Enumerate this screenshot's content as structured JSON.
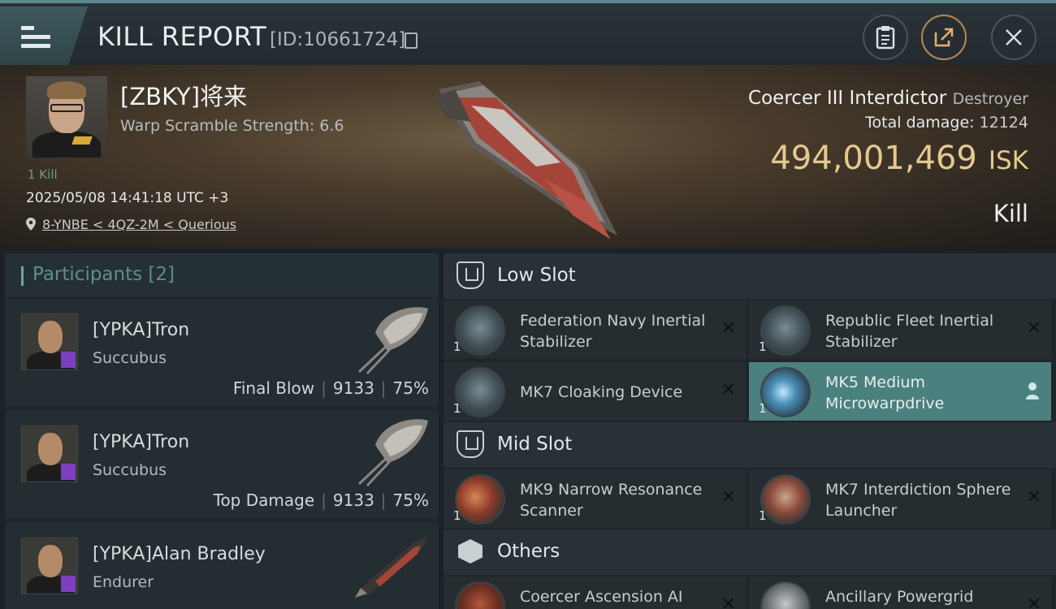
{
  "header": {
    "title": "KILL REPORT",
    "report_id": "[ID:10661724]"
  },
  "victim": {
    "name": "[ZBKY]将来",
    "warp_scramble": "Warp Scramble Strength: 6.6",
    "kills": "1 Kill",
    "timestamp": "2025/05/08 14:41:18 UTC +3",
    "location": "8-YNBE < 4QZ-2M < Querious"
  },
  "ship": {
    "name": "Coercer III Interdictor",
    "class": "Destroyer",
    "total_damage_label": "Total damage:",
    "total_damage": "12124",
    "isk_value": "494,001,469",
    "isk_unit": "ISK",
    "result": "Kill"
  },
  "participants": {
    "header": "Participants [2]",
    "list": [
      {
        "name": "[YPKA]Tron",
        "ship": "Succubus",
        "role": "Final Blow",
        "damage": "9133",
        "percent": "75%"
      },
      {
        "name": "[YPKA]Tron",
        "ship": "Succubus",
        "role": "Top Damage",
        "damage": "9133",
        "percent": "75%"
      },
      {
        "name": "[YPKA]Alan Bradley",
        "ship": "Endurer"
      }
    ]
  },
  "fitting": {
    "low_slot": {
      "label": "Low Slot",
      "modules": [
        {
          "name": "Federation Navy Inertial Stabilizer",
          "qty": "1"
        },
        {
          "name": "Republic Fleet Inertial Stabilizer",
          "qty": "1"
        },
        {
          "name": "MK7 Cloaking Device",
          "qty": "1"
        },
        {
          "name": "MK5 Medium Microwarpdrive",
          "qty": "1"
        }
      ]
    },
    "mid_slot": {
      "label": "Mid Slot",
      "modules": [
        {
          "name": "MK9 Narrow Resonance Scanner",
          "qty": "1"
        },
        {
          "name": "MK7 Interdiction Sphere Launcher",
          "qty": "1"
        }
      ]
    },
    "others": {
      "label": "Others",
      "modules": [
        {
          "name": "Coercer Ascension AI"
        },
        {
          "name": "Ancillary Powergrid"
        }
      ]
    }
  },
  "colors": {
    "accent_teal": "#4a807e",
    "isk_gold": "#e5c98e",
    "share_orange": "#e6b06b",
    "badge_purple": "#7b3fbf"
  }
}
